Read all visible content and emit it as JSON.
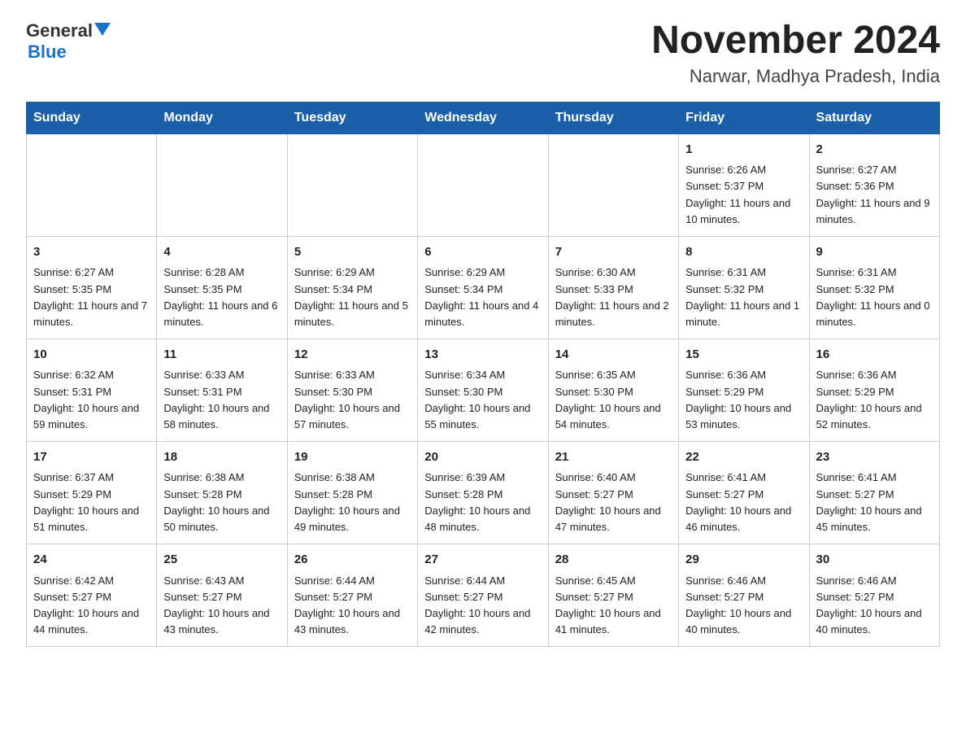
{
  "header": {
    "logo_general": "General",
    "logo_blue": "Blue",
    "title": "November 2024",
    "subtitle": "Narwar, Madhya Pradesh, India"
  },
  "days_of_week": [
    "Sunday",
    "Monday",
    "Tuesday",
    "Wednesday",
    "Thursday",
    "Friday",
    "Saturday"
  ],
  "weeks": [
    [
      {
        "day": "",
        "info": ""
      },
      {
        "day": "",
        "info": ""
      },
      {
        "day": "",
        "info": ""
      },
      {
        "day": "",
        "info": ""
      },
      {
        "day": "",
        "info": ""
      },
      {
        "day": "1",
        "info": "Sunrise: 6:26 AM\nSunset: 5:37 PM\nDaylight: 11 hours and 10 minutes."
      },
      {
        "day": "2",
        "info": "Sunrise: 6:27 AM\nSunset: 5:36 PM\nDaylight: 11 hours and 9 minutes."
      }
    ],
    [
      {
        "day": "3",
        "info": "Sunrise: 6:27 AM\nSunset: 5:35 PM\nDaylight: 11 hours and 7 minutes."
      },
      {
        "day": "4",
        "info": "Sunrise: 6:28 AM\nSunset: 5:35 PM\nDaylight: 11 hours and 6 minutes."
      },
      {
        "day": "5",
        "info": "Sunrise: 6:29 AM\nSunset: 5:34 PM\nDaylight: 11 hours and 5 minutes."
      },
      {
        "day": "6",
        "info": "Sunrise: 6:29 AM\nSunset: 5:34 PM\nDaylight: 11 hours and 4 minutes."
      },
      {
        "day": "7",
        "info": "Sunrise: 6:30 AM\nSunset: 5:33 PM\nDaylight: 11 hours and 2 minutes."
      },
      {
        "day": "8",
        "info": "Sunrise: 6:31 AM\nSunset: 5:32 PM\nDaylight: 11 hours and 1 minute."
      },
      {
        "day": "9",
        "info": "Sunrise: 6:31 AM\nSunset: 5:32 PM\nDaylight: 11 hours and 0 minutes."
      }
    ],
    [
      {
        "day": "10",
        "info": "Sunrise: 6:32 AM\nSunset: 5:31 PM\nDaylight: 10 hours and 59 minutes."
      },
      {
        "day": "11",
        "info": "Sunrise: 6:33 AM\nSunset: 5:31 PM\nDaylight: 10 hours and 58 minutes."
      },
      {
        "day": "12",
        "info": "Sunrise: 6:33 AM\nSunset: 5:30 PM\nDaylight: 10 hours and 57 minutes."
      },
      {
        "day": "13",
        "info": "Sunrise: 6:34 AM\nSunset: 5:30 PM\nDaylight: 10 hours and 55 minutes."
      },
      {
        "day": "14",
        "info": "Sunrise: 6:35 AM\nSunset: 5:30 PM\nDaylight: 10 hours and 54 minutes."
      },
      {
        "day": "15",
        "info": "Sunrise: 6:36 AM\nSunset: 5:29 PM\nDaylight: 10 hours and 53 minutes."
      },
      {
        "day": "16",
        "info": "Sunrise: 6:36 AM\nSunset: 5:29 PM\nDaylight: 10 hours and 52 minutes."
      }
    ],
    [
      {
        "day": "17",
        "info": "Sunrise: 6:37 AM\nSunset: 5:29 PM\nDaylight: 10 hours and 51 minutes."
      },
      {
        "day": "18",
        "info": "Sunrise: 6:38 AM\nSunset: 5:28 PM\nDaylight: 10 hours and 50 minutes."
      },
      {
        "day": "19",
        "info": "Sunrise: 6:38 AM\nSunset: 5:28 PM\nDaylight: 10 hours and 49 minutes."
      },
      {
        "day": "20",
        "info": "Sunrise: 6:39 AM\nSunset: 5:28 PM\nDaylight: 10 hours and 48 minutes."
      },
      {
        "day": "21",
        "info": "Sunrise: 6:40 AM\nSunset: 5:27 PM\nDaylight: 10 hours and 47 minutes."
      },
      {
        "day": "22",
        "info": "Sunrise: 6:41 AM\nSunset: 5:27 PM\nDaylight: 10 hours and 46 minutes."
      },
      {
        "day": "23",
        "info": "Sunrise: 6:41 AM\nSunset: 5:27 PM\nDaylight: 10 hours and 45 minutes."
      }
    ],
    [
      {
        "day": "24",
        "info": "Sunrise: 6:42 AM\nSunset: 5:27 PM\nDaylight: 10 hours and 44 minutes."
      },
      {
        "day": "25",
        "info": "Sunrise: 6:43 AM\nSunset: 5:27 PM\nDaylight: 10 hours and 43 minutes."
      },
      {
        "day": "26",
        "info": "Sunrise: 6:44 AM\nSunset: 5:27 PM\nDaylight: 10 hours and 43 minutes."
      },
      {
        "day": "27",
        "info": "Sunrise: 6:44 AM\nSunset: 5:27 PM\nDaylight: 10 hours and 42 minutes."
      },
      {
        "day": "28",
        "info": "Sunrise: 6:45 AM\nSunset: 5:27 PM\nDaylight: 10 hours and 41 minutes."
      },
      {
        "day": "29",
        "info": "Sunrise: 6:46 AM\nSunset: 5:27 PM\nDaylight: 10 hours and 40 minutes."
      },
      {
        "day": "30",
        "info": "Sunrise: 6:46 AM\nSunset: 5:27 PM\nDaylight: 10 hours and 40 minutes."
      }
    ]
  ]
}
